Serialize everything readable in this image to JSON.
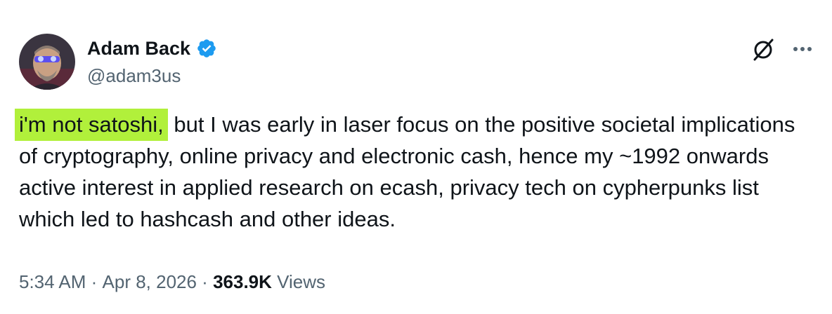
{
  "author": {
    "display_name": "Adam Back",
    "handle": "@adam3us",
    "verified": true,
    "avatar_icon": "profile-photo"
  },
  "actions": {
    "grok_icon": "grok-icon",
    "more_icon": "more-icon"
  },
  "tweet": {
    "highlighted_text": "i'm not satoshi,",
    "body_text": " but I was early in laser focus on the positive societal implications of cryptography, online privacy and electronic cash, hence my ~1992 onwards active interest in applied research on ecash, privacy tech on cypherpunks list which led to hashcash and other ideas.",
    "highlight_color": "#b1f03b"
  },
  "meta": {
    "time": "5:34 AM",
    "separator": " · ",
    "date": "Apr 8, 2026",
    "views_count": "363.9K",
    "views_label": " Views"
  },
  "colors": {
    "text_primary": "#0f1419",
    "text_secondary": "#536471",
    "verified_blue": "#1d9bf0"
  }
}
